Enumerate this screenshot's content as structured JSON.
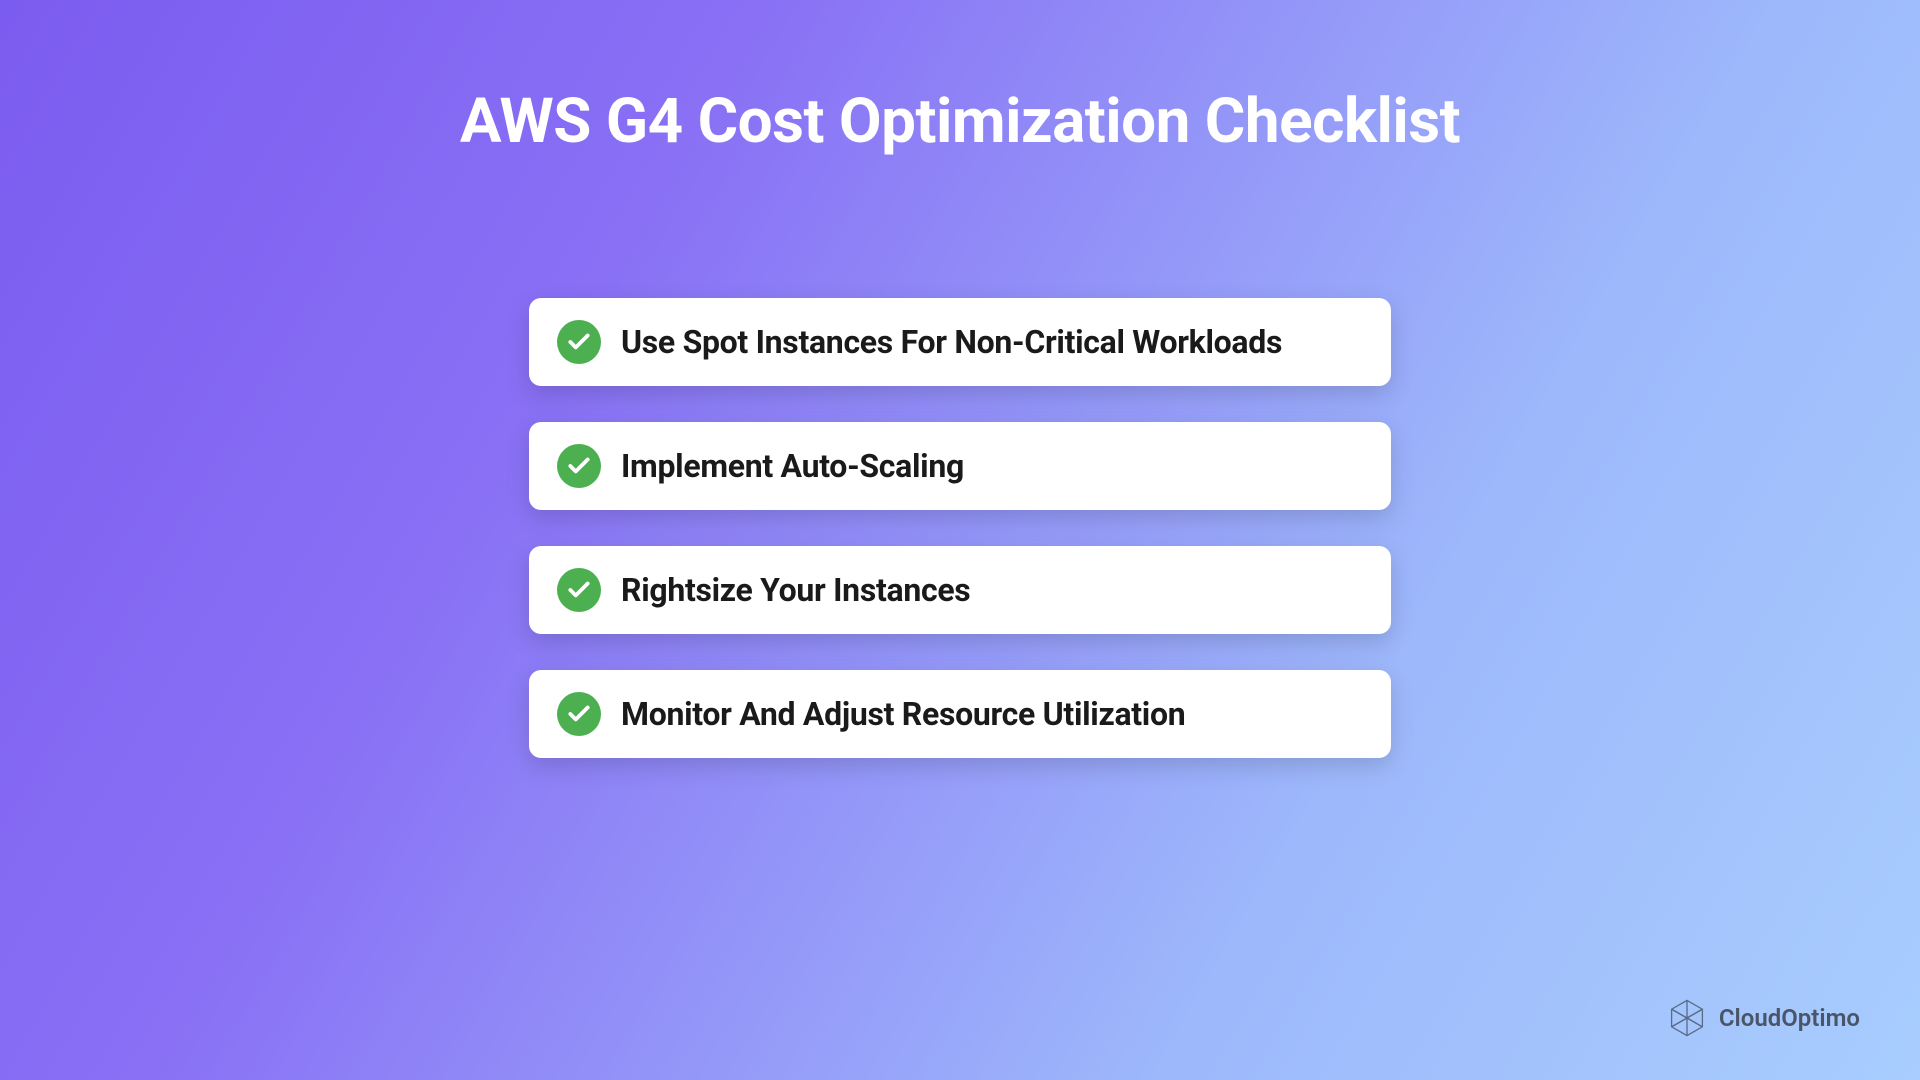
{
  "title": "AWS G4 Cost Optimization Checklist",
  "checklist": {
    "items": [
      {
        "label": "Use Spot Instances For Non-Critical Workloads"
      },
      {
        "label": "Implement Auto-Scaling"
      },
      {
        "label": "Rightsize Your Instances"
      },
      {
        "label": "Monitor And Adjust Resource Utilization"
      }
    ]
  },
  "brand": {
    "name": "CloudOptimo"
  }
}
